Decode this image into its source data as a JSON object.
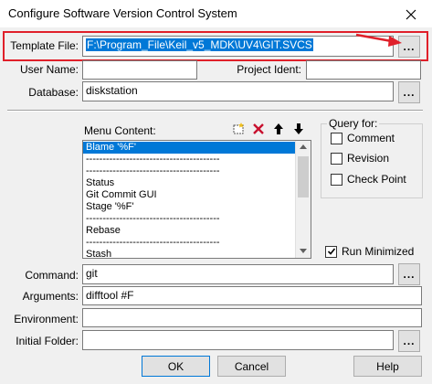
{
  "window": {
    "title": "Configure Software Version Control System",
    "close_glyph": "✕"
  },
  "fields": {
    "template_file": {
      "label": "Template File:",
      "value": "F:\\Program_File\\Keil_v5_MDK\\UV4\\GIT.SVCS"
    },
    "user_name": {
      "label": "User Name:",
      "value": ""
    },
    "project_ident": {
      "label": "Project Ident:",
      "value": ""
    },
    "database": {
      "label": "Database:",
      "value": "diskstation"
    },
    "command": {
      "label": "Command:",
      "value": "git"
    },
    "arguments": {
      "label": "Arguments:",
      "value": "difftool #F"
    },
    "environment": {
      "label": "Environment:",
      "value": ""
    },
    "initial_folder": {
      "label": "Initial Folder:",
      "value": ""
    }
  },
  "browse_label": "...",
  "menu": {
    "label": "Menu Content:",
    "items": [
      "Blame '%F'",
      "----------------------------------------",
      "----------------------------------------",
      "Status",
      "Git Commit GUI",
      "Stage '%F'",
      "----------------------------------------",
      "Rebase",
      "----------------------------------------",
      "Stash"
    ],
    "toolbar_icons": [
      "new-item-icon",
      "delete-icon",
      "move-up-icon",
      "move-down-icon"
    ]
  },
  "query": {
    "title": "Query for:",
    "options": [
      {
        "label": "Comment",
        "checked": false
      },
      {
        "label": "Revision",
        "checked": false
      },
      {
        "label": "Check Point",
        "checked": false
      }
    ]
  },
  "run_minimized": {
    "label": "Run Minimized",
    "checked": true
  },
  "buttons": {
    "ok": "OK",
    "cancel": "Cancel",
    "help": "Help"
  },
  "colors": {
    "selection": "#0078d7",
    "highlight_frame": "#e0202a",
    "arrow": "#e0202a"
  }
}
